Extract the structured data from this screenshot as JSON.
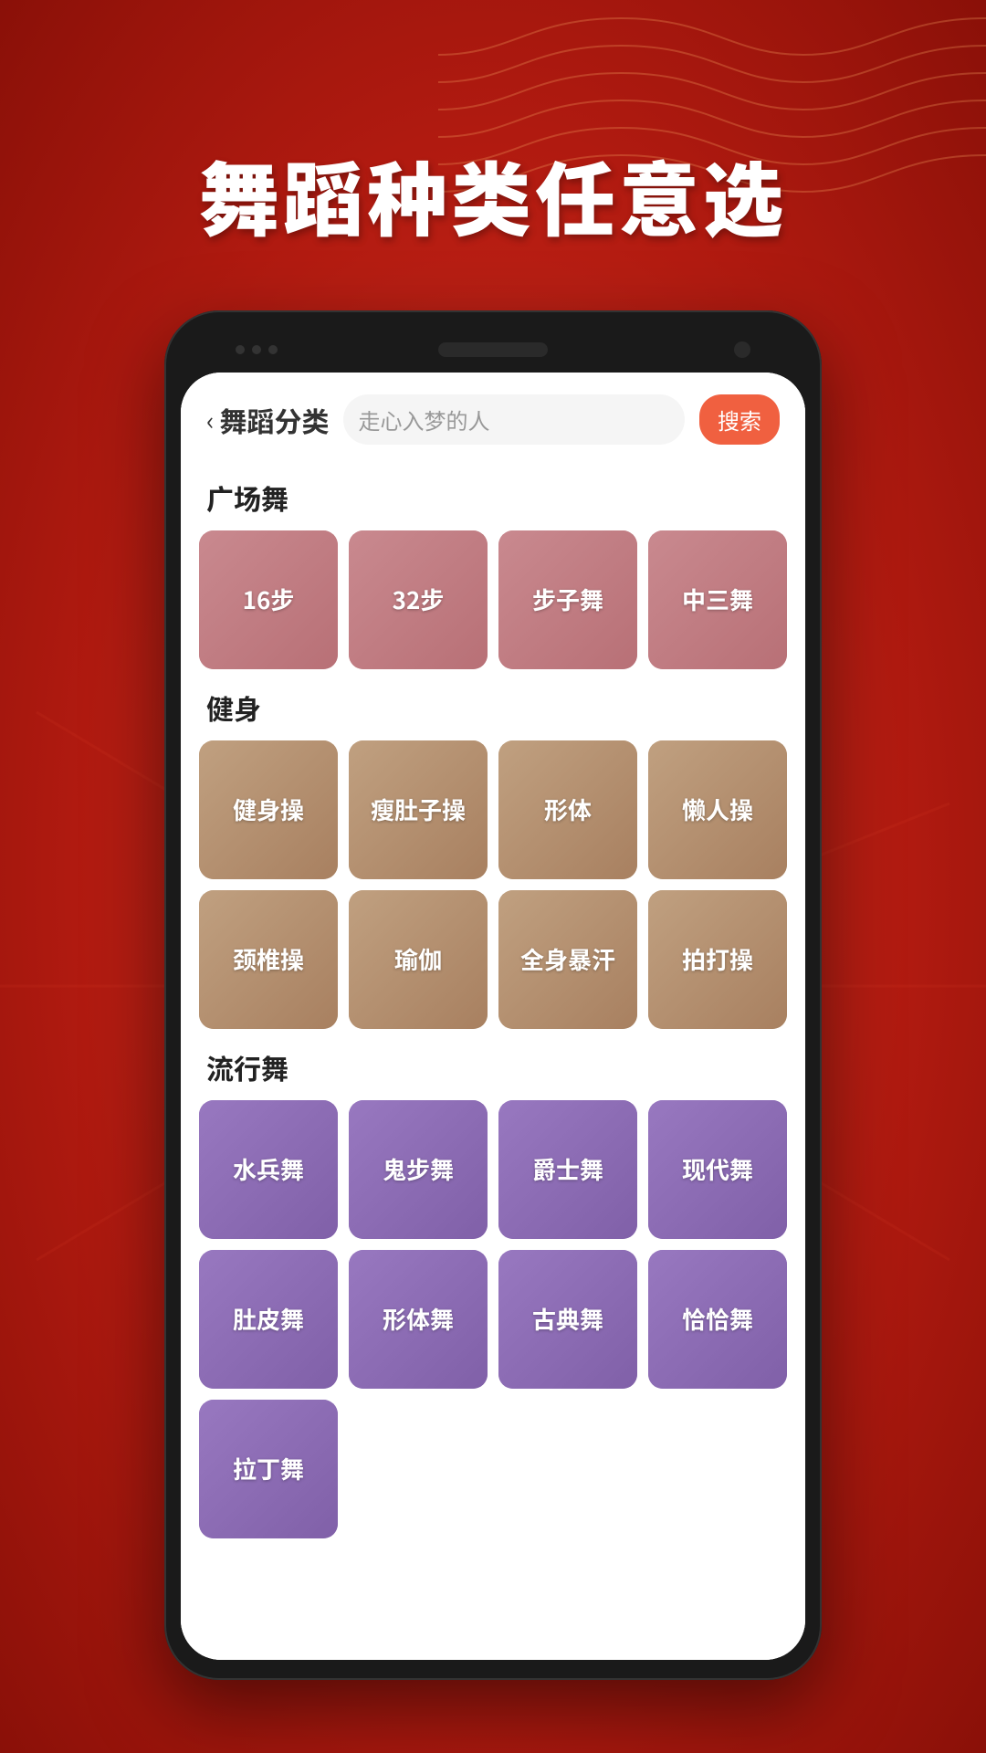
{
  "page": {
    "background_color": "#c0271a",
    "title": "舞蹈种类任意选"
  },
  "header": {
    "back_label": "舞蹈分类",
    "search_placeholder": "走心入梦的人",
    "search_button_label": "搜索"
  },
  "sections": [
    {
      "id": "square-dance",
      "title": "广场舞",
      "tile_style": "tile-square",
      "tiles": [
        {
          "label": "16步"
        },
        {
          "label": "32步"
        },
        {
          "label": "步子舞"
        },
        {
          "label": "中三舞"
        }
      ]
    },
    {
      "id": "fitness",
      "title": "健身",
      "tile_style": "tile-fitness",
      "tiles": [
        {
          "label": "健身操"
        },
        {
          "label": "瘦肚子操"
        },
        {
          "label": "形体"
        },
        {
          "label": "懒人操"
        },
        {
          "label": "颈椎操"
        },
        {
          "label": "瑜伽"
        },
        {
          "label": "全身暴汗"
        },
        {
          "label": "拍打操"
        }
      ]
    },
    {
      "id": "pop-dance",
      "title": "流行舞",
      "tile_style": "tile-pop",
      "tiles": [
        {
          "label": "水兵舞"
        },
        {
          "label": "鬼步舞"
        },
        {
          "label": "爵士舞"
        },
        {
          "label": "现代舞"
        },
        {
          "label": "肚皮舞"
        },
        {
          "label": "形体舞"
        },
        {
          "label": "古典舞"
        },
        {
          "label": "恰恰舞"
        },
        {
          "label": "拉丁舞"
        }
      ]
    }
  ]
}
